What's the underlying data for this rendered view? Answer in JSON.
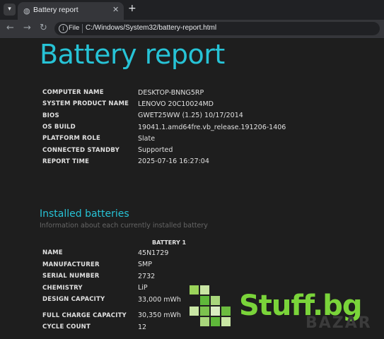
{
  "browser": {
    "tab_title": "Battery report",
    "tab_close": "✕",
    "new_tab": "+",
    "omnibox_chip": "File",
    "url": "C:/Windows/System32/battery-report.html"
  },
  "report": {
    "title": "Battery report",
    "system_info": [
      {
        "label": "COMPUTER NAME",
        "value": "DESKTOP-BNNG5RP"
      },
      {
        "label": "SYSTEM PRODUCT NAME",
        "value": "LENOVO 20C10024MD"
      },
      {
        "label": "BIOS",
        "value": "GWET25WW (1.25) 10/17/2014"
      },
      {
        "label": "OS BUILD",
        "value": "19041.1.amd64fre.vb_release.191206-1406"
      },
      {
        "label": "PLATFORM ROLE",
        "value": "Slate"
      },
      {
        "label": "CONNECTED STANDBY",
        "value": "Supported"
      },
      {
        "label": "REPORT TIME",
        "value": "2025-07-16  16:27:04"
      }
    ],
    "installed": {
      "heading": "Installed batteries",
      "subtitle": "Information about each currently installed battery",
      "column_header": "BATTERY 1",
      "rows": [
        {
          "label": "NAME",
          "value": "45N1729"
        },
        {
          "label": "MANUFACTURER",
          "value": "SMP"
        },
        {
          "label": "SERIAL NUMBER",
          "value": "2732"
        },
        {
          "label": "CHEMISTRY",
          "value": "LiP"
        },
        {
          "label": "DESIGN CAPACITY",
          "value": "33,000 mWh"
        },
        {
          "label": "FULL CHARGE CAPACITY",
          "value": "30,350 mWh"
        },
        {
          "label": "CYCLE COUNT",
          "value": "12"
        }
      ]
    }
  },
  "watermark": {
    "text": "Stuff.bg",
    "ghost_text": "BAZAR"
  },
  "colors": {
    "accent": "#27c3d6",
    "watermark_green": "#7ad43a",
    "background": "#1e1e1e"
  }
}
